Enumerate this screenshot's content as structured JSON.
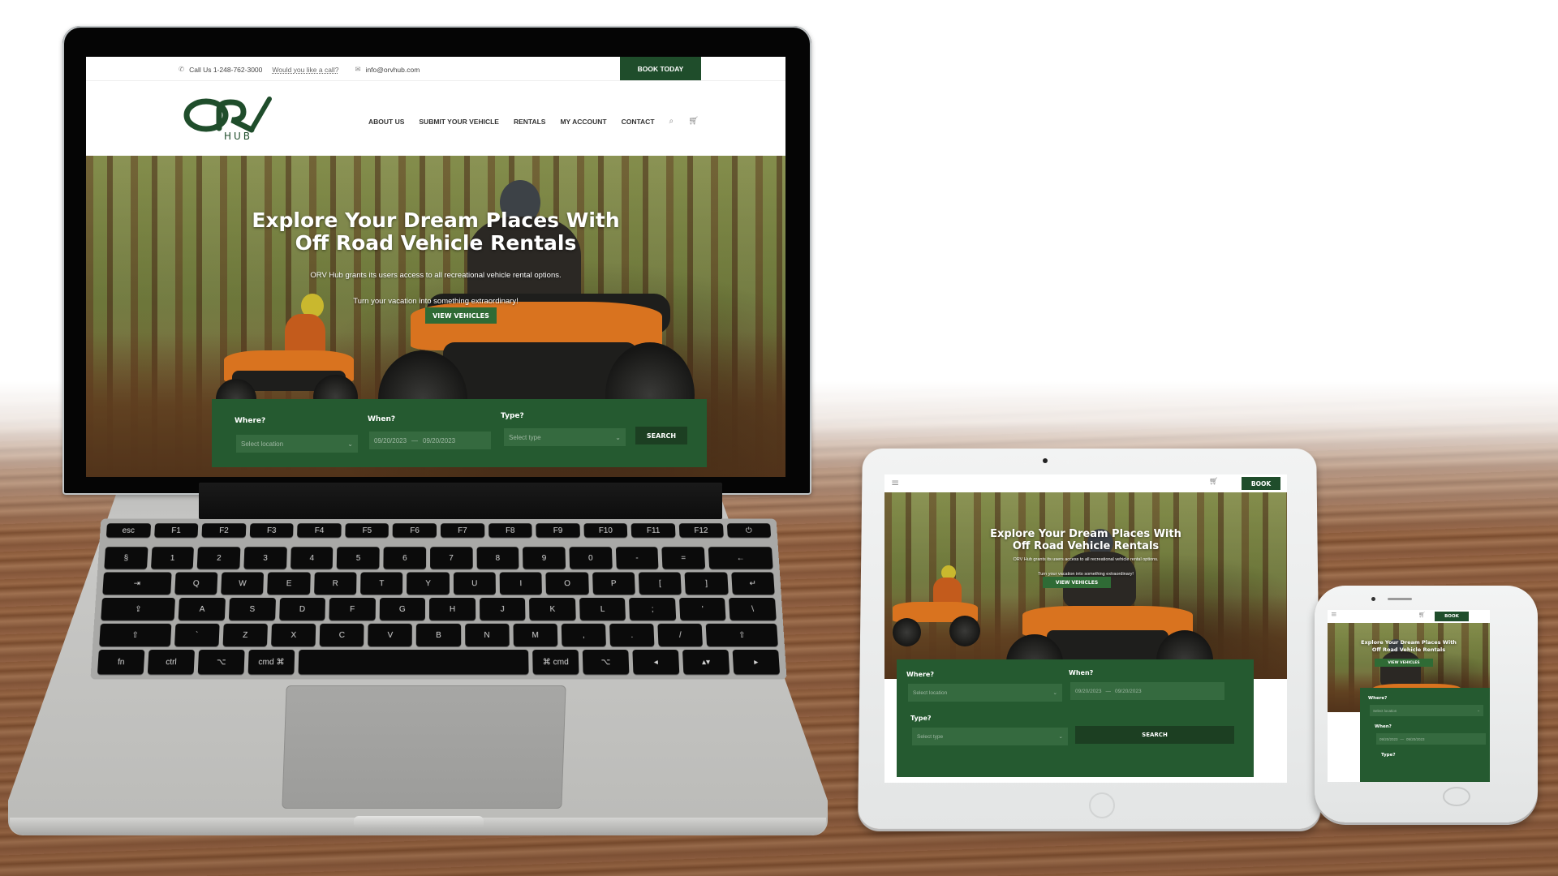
{
  "scene": {
    "description": "Responsive website mockup on laptop, tablet and phone",
    "brand_color": "#1f4d2b",
    "panel_color": "#255a30",
    "button_color": "#2f6b35"
  },
  "site": {
    "topbar": {
      "phone_label": "Call Us 1-248-762-3000",
      "callback_link": "Would you like a call?",
      "email": "info@orvhub.com",
      "book_button": "BOOK TODAY"
    },
    "logo": {
      "main": "ORV",
      "sub": "HUB"
    },
    "nav": {
      "items": [
        {
          "label": "ABOUT US"
        },
        {
          "label": "SUBMIT YOUR VEHICLE"
        },
        {
          "label": "RENTALS"
        },
        {
          "label": "MY ACCOUNT"
        },
        {
          "label": "CONTACT"
        }
      ],
      "search_icon": "search-icon",
      "cart_icon": "cart-icon"
    },
    "hero": {
      "title_line1": "Explore Your Dream Places With",
      "title_line2": "Off Road Vehicle Rentals",
      "subtitle1": "ORV Hub grants its users access to all recreational vehicle rental options.",
      "subtitle2": "Turn your vacation into something extraordinary!",
      "cta": "VIEW VEHICLES"
    },
    "search": {
      "where_label": "Where?",
      "where_placeholder": "Select location",
      "when_label": "When?",
      "date_from": "09/20/2023",
      "date_sep": "—",
      "date_to": "09/20/2023",
      "type_label": "Type?",
      "type_placeholder": "Select type",
      "search_button": "SEARCH"
    },
    "mobile": {
      "book_button": "BOOK",
      "menu_icon": "hamburger-menu-icon"
    }
  },
  "keyboard": {
    "rows": [
      [
        "esc",
        "F1",
        "F2",
        "F3",
        "F4",
        "F5",
        "F6",
        "F7",
        "F8",
        "F9",
        "F10",
        "F11",
        "F12",
        "⏻"
      ],
      [
        "§",
        "1",
        "2",
        "3",
        "4",
        "5",
        "6",
        "7",
        "8",
        "9",
        "0",
        "-",
        "=",
        "←"
      ],
      [
        "⇥",
        "Q",
        "W",
        "E",
        "R",
        "T",
        "Y",
        "U",
        "I",
        "O",
        "P",
        "[",
        "]",
        "↵"
      ],
      [
        "⇪",
        "A",
        "S",
        "D",
        "F",
        "G",
        "H",
        "J",
        "K",
        "L",
        ";",
        "'",
        "\\"
      ],
      [
        "⇧",
        "`",
        "Z",
        "X",
        "C",
        "V",
        "B",
        "N",
        "M",
        ",",
        ".",
        "/",
        "⇧"
      ],
      [
        "fn",
        "ctrl",
        "⌥",
        "cmd ⌘",
        "",
        "⌘ cmd",
        "⌥",
        "◂",
        "▴▾",
        "▸"
      ]
    ]
  }
}
